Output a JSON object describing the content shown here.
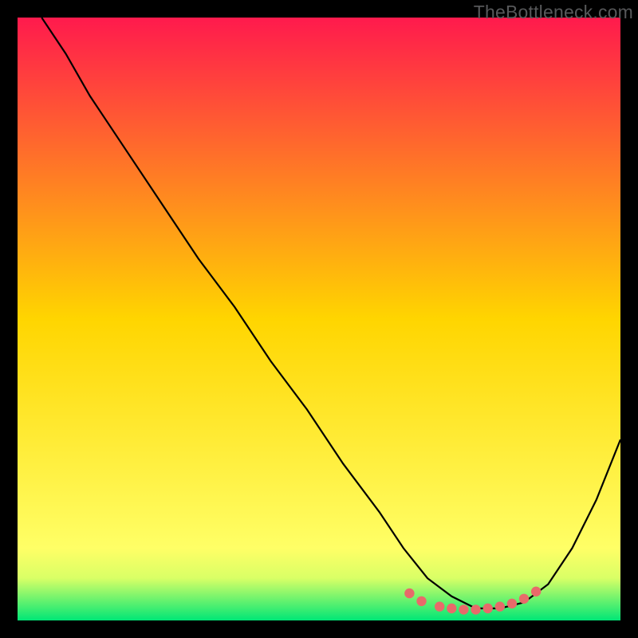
{
  "watermark": "TheBottleneck.com",
  "chart_data": {
    "type": "line",
    "title": "",
    "xlabel": "",
    "ylabel": "",
    "xlim": [
      0,
      100
    ],
    "ylim": [
      0,
      100
    ],
    "background_gradient": {
      "stops": [
        {
          "offset": 0,
          "color": "#ff1a4d"
        },
        {
          "offset": 50,
          "color": "#ffd500"
        },
        {
          "offset": 88,
          "color": "#ffff66"
        },
        {
          "offset": 93,
          "color": "#d9ff66"
        },
        {
          "offset": 100,
          "color": "#00e676"
        }
      ]
    },
    "series": [
      {
        "name": "bottleneck-curve",
        "color": "#000000",
        "x": [
          4,
          8,
          12,
          18,
          24,
          30,
          36,
          42,
          48,
          54,
          60,
          64,
          68,
          72,
          76,
          80,
          84,
          88,
          92,
          96,
          100
        ],
        "y": [
          100,
          94,
          87,
          78,
          69,
          60,
          52,
          43,
          35,
          26,
          18,
          12,
          7,
          4,
          2,
          2,
          3,
          6,
          12,
          20,
          30
        ]
      }
    ],
    "markers": {
      "name": "optimal-range-markers",
      "color": "#e86a6a",
      "points": [
        {
          "x": 65,
          "y": 4.5
        },
        {
          "x": 67,
          "y": 3.2
        },
        {
          "x": 70,
          "y": 2.3
        },
        {
          "x": 72,
          "y": 2.0
        },
        {
          "x": 74,
          "y": 1.8
        },
        {
          "x": 76,
          "y": 1.8
        },
        {
          "x": 78,
          "y": 2.0
        },
        {
          "x": 80,
          "y": 2.3
        },
        {
          "x": 82,
          "y": 2.8
        },
        {
          "x": 84,
          "y": 3.6
        },
        {
          "x": 86,
          "y": 4.8
        }
      ]
    }
  }
}
